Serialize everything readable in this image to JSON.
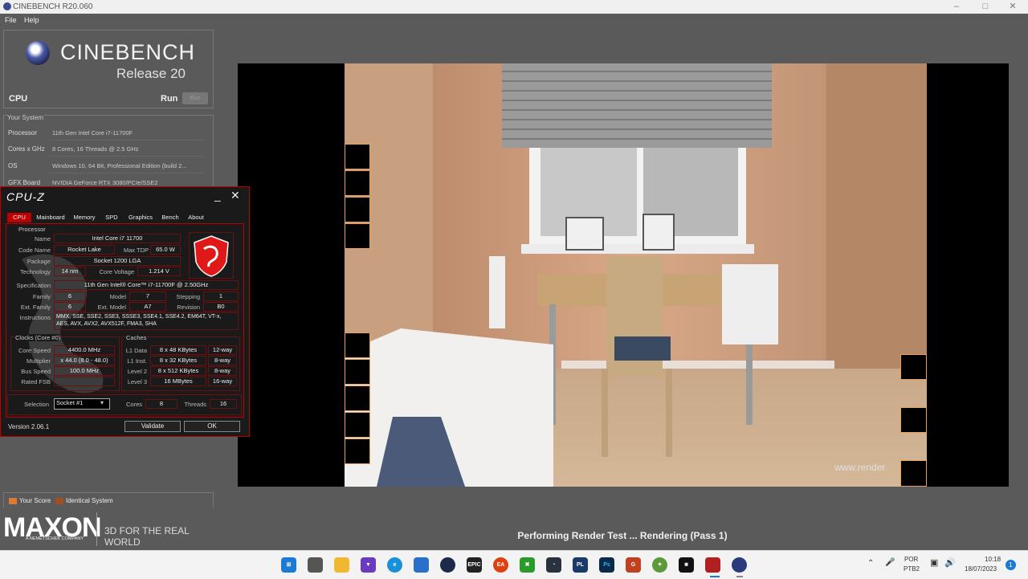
{
  "window": {
    "title": "CINEBENCH R20.060"
  },
  "menu": [
    "File",
    "Help"
  ],
  "brand": {
    "name": "CINEBENCH",
    "release": "Release 20"
  },
  "cpu_row": {
    "label": "CPU",
    "run_label": "Run",
    "run_button": "Run"
  },
  "system": {
    "header": "Your System",
    "rows": [
      {
        "label": "Processor",
        "value": "11th Gen Intel Core i7-11700F"
      },
      {
        "label": "Cores x GHz",
        "value": "8 Cores, 16 Threads @ 2.5 GHz"
      },
      {
        "label": "OS",
        "value": "Windows 10, 64 Bit, Professional Edition (build 2..."
      },
      {
        "label": "GFX Board",
        "value": "NVIDIA GeForce RTX 3080/PCIe/SSE2"
      }
    ]
  },
  "legend": {
    "your_score": "Your Score",
    "identical": "Identical System",
    "your_color": "#e07a30",
    "identical_color": "#a05020"
  },
  "footer": {
    "logo": "MAXON",
    "logo_sub": "A NEMETSCHEK COMPANY",
    "tagline": "3D FOR THE REAL WORLD"
  },
  "render": {
    "status": "Performing Render Test ... Rendering (Pass 1)",
    "watermark": "www.render"
  },
  "cpuz": {
    "title": "CPU-Z",
    "tabs": [
      "CPU",
      "Mainboard",
      "Memory",
      "SPD",
      "Graphics",
      "Bench",
      "About"
    ],
    "processor_section": "Processor",
    "name_label": "Name",
    "name": "Intel Core i7 11700",
    "codename_label": "Code Name",
    "codename": "Rocket Lake",
    "maxtdp_label": "Max TDP",
    "maxtdp": "65.0 W",
    "package_label": "Package",
    "package": "Socket 1200 LGA",
    "technology_label": "Technology",
    "technology": "14 nm",
    "corevoltage_label": "Core Voltage",
    "corevoltage": "1.214 V",
    "spec_label": "Specification",
    "spec": "11th Gen Intel® Core™ i7-11700F @ 2.50GHz",
    "family_label": "Family",
    "family": "6",
    "model_label": "Model",
    "model": "7",
    "stepping_label": "Stepping",
    "stepping": "1",
    "extfamily_label": "Ext. Family",
    "extfamily": "6",
    "extmodel_label": "Ext. Model",
    "extmodel": "A7",
    "revision_label": "Revision",
    "revision": "B0",
    "instructions_label": "Instructions",
    "instructions_1": "MMX, SSE, SSE2, SSE3, SSSE3, SSE4.1, SSE4.2, EM64T, VT-x,",
    "instructions_2": "AES, AVX, AVX2, AVX512F, FMA3, SHA",
    "clocks_section": "Clocks (Core #0)",
    "corespeed_label": "Core Speed",
    "corespeed": "4400.0 MHz",
    "multiplier_label": "Multiplier",
    "multiplier": "x 44.0 (8.0 - 48.0)",
    "busspeed_label": "Bus Speed",
    "busspeed": "100.0 MHz",
    "ratedfsb_label": "Rated FSB",
    "ratedfsb": "",
    "caches_section": "Caches",
    "l1data_label": "L1 Data",
    "l1data": "8 x 48 KBytes",
    "l1data_way": "12-way",
    "l1inst_label": "L1 Inst.",
    "l1inst": "8 x 32 KBytes",
    "l1inst_way": "8-way",
    "level2_label": "Level 2",
    "level2": "8 x 512 KBytes",
    "level2_way": "8-way",
    "level3_label": "Level 3",
    "level3": "16 MBytes",
    "level3_way": "16-way",
    "selection_label": "Selection",
    "selection": "Socket #1",
    "cores_label": "Cores",
    "cores": "8",
    "threads_label": "Threads",
    "threads": "16",
    "version": "Version 2.06.1",
    "validate": "Validate",
    "ok": "OK"
  },
  "taskbar": {
    "lang": "POR",
    "layout": "PTB2",
    "time": "10:18",
    "date": "18/07/2023",
    "notifications": "1",
    "icons": [
      "windows-start-icon",
      "file-explorer-icon",
      "folder-icon",
      "proton-vpn-icon",
      "edge-icon",
      "store-icon",
      "steam-icon",
      "epic-games-icon",
      "ea-app-icon",
      "xbox-icon",
      "speed-gauge-icon",
      "pl-app-icon",
      "photoshop-icon",
      "g-app-icon",
      "kodi-icon",
      "capcut-icon",
      "gpu-z-icon",
      "cinebench-icon"
    ]
  }
}
